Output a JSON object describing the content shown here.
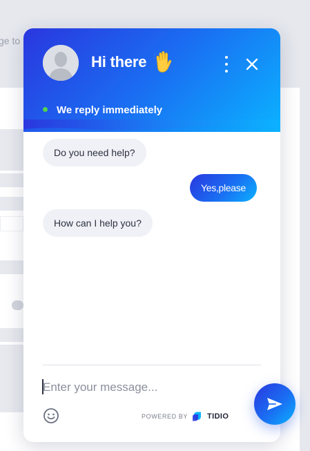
{
  "background": {
    "snippet_text": "ge to r"
  },
  "header": {
    "title": "Hi there",
    "status_text": "We reply immediately",
    "status_color": "#52d34d",
    "icons": [
      "avatar-placeholder",
      "waving-hand-emoji",
      "more-vertical-icon",
      "close-icon"
    ]
  },
  "messages": [
    {
      "sender": "bot",
      "text": "Do you need help?"
    },
    {
      "sender": "user",
      "text": "Yes,please"
    },
    {
      "sender": "bot",
      "text": "How can I help you?"
    }
  ],
  "composer": {
    "placeholder": "Enter your message...",
    "value": "",
    "emoji_icon": "smiley-icon",
    "send_icon": "send-icon"
  },
  "footer": {
    "powered_by": "POWERED BY",
    "brand": "TIDIO"
  },
  "colors": {
    "gradient_start": "#2a37df",
    "gradient_end": "#0bb2ff",
    "bot_bubble": "#eff1f6",
    "text_dark": "#2d3140"
  }
}
